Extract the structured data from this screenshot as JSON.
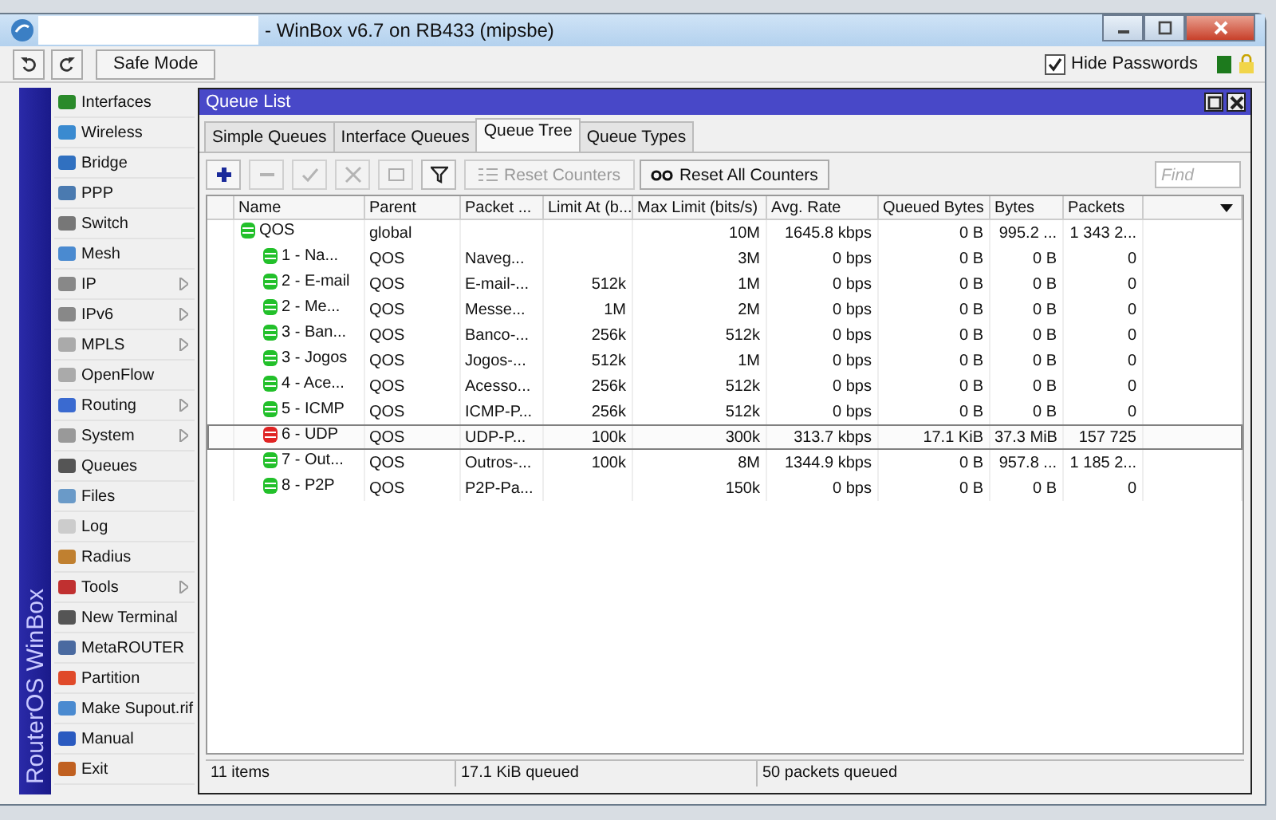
{
  "window": {
    "title": "- WinBox v6.7 on RB433 (mipsbe)"
  },
  "toolbar": {
    "safe_mode": "Safe Mode",
    "hide_passwords": {
      "label": "Hide Passwords",
      "checked": true
    }
  },
  "sidebar": {
    "brand": "RouterOS WinBox",
    "items": [
      {
        "label": "Interfaces",
        "has_submenu": false
      },
      {
        "label": "Wireless",
        "has_submenu": false
      },
      {
        "label": "Bridge",
        "has_submenu": false
      },
      {
        "label": "PPP",
        "has_submenu": false
      },
      {
        "label": "Switch",
        "has_submenu": false
      },
      {
        "label": "Mesh",
        "has_submenu": false
      },
      {
        "label": "IP",
        "has_submenu": true
      },
      {
        "label": "IPv6",
        "has_submenu": true
      },
      {
        "label": "MPLS",
        "has_submenu": true
      },
      {
        "label": "OpenFlow",
        "has_submenu": false
      },
      {
        "label": "Routing",
        "has_submenu": true
      },
      {
        "label": "System",
        "has_submenu": true
      },
      {
        "label": "Queues",
        "has_submenu": false
      },
      {
        "label": "Files",
        "has_submenu": false
      },
      {
        "label": "Log",
        "has_submenu": false
      },
      {
        "label": "Radius",
        "has_submenu": false
      },
      {
        "label": "Tools",
        "has_submenu": true
      },
      {
        "label": "New Terminal",
        "has_submenu": false
      },
      {
        "label": "MetaROUTER",
        "has_submenu": false
      },
      {
        "label": "Partition",
        "has_submenu": false
      },
      {
        "label": "Make Supout.rif",
        "has_submenu": false
      },
      {
        "label": "Manual",
        "has_submenu": false
      },
      {
        "label": "Exit",
        "has_submenu": false
      }
    ]
  },
  "queue_list": {
    "title": "Queue List",
    "tabs": [
      {
        "label": "Simple Queues",
        "selected": false
      },
      {
        "label": "Interface Queues",
        "selected": false
      },
      {
        "label": "Queue Tree",
        "selected": true
      },
      {
        "label": "Queue Types",
        "selected": false
      }
    ],
    "tools": [
      {
        "kind": "add",
        "disabled": false
      },
      {
        "kind": "remove",
        "disabled": true
      },
      {
        "kind": "enable",
        "disabled": true
      },
      {
        "kind": "disable",
        "disabled": true
      },
      {
        "kind": "comment",
        "disabled": true
      },
      {
        "kind": "filter",
        "disabled": false
      }
    ],
    "buttons": [
      {
        "kind": "reset",
        "label": "Reset Counters",
        "disabled": true
      },
      {
        "kind": "reset-all",
        "label": "Reset All Counters",
        "disabled": false
      }
    ],
    "search": {
      "placeholder": "Find"
    },
    "table": {
      "columns": [
        "Name",
        "Parent",
        "Packet ...",
        "Limit At (b...",
        "Max Limit (bits/s)",
        "Avg. Rate",
        "Queued Bytes",
        "Bytes",
        "Packets"
      ],
      "rows": [
        {
          "cells": [
            "QOS",
            "global",
            "",
            "",
            "10M",
            "1645.8 kbps",
            "0 B",
            "995.2 ...",
            "1 343 2..."
          ],
          "color": "#22c02a",
          "selected": false,
          "children": [
            {
              "cells": [
                "1 - Na...",
                "QOS",
                "Naveg...",
                "",
                "3M",
                "0 bps",
                "0 B",
                "0 B",
                "0"
              ],
              "color": "#22c02a",
              "selected": false
            },
            {
              "cells": [
                "2 - E-mail",
                "QOS",
                "E-mail-...",
                "512k",
                "1M",
                "0 bps",
                "0 B",
                "0 B",
                "0"
              ],
              "color": "#22c02a",
              "selected": false
            },
            {
              "cells": [
                "2 - Me...",
                "QOS",
                "Messe...",
                "1M",
                "2M",
                "0 bps",
                "0 B",
                "0 B",
                "0"
              ],
              "color": "#22c02a",
              "selected": false
            },
            {
              "cells": [
                "3 - Ban...",
                "QOS",
                "Banco-...",
                "256k",
                "512k",
                "0 bps",
                "0 B",
                "0 B",
                "0"
              ],
              "color": "#22c02a",
              "selected": false
            },
            {
              "cells": [
                "3 - Jogos",
                "QOS",
                "Jogos-...",
                "512k",
                "1M",
                "0 bps",
                "0 B",
                "0 B",
                "0"
              ],
              "color": "#22c02a",
              "selected": false
            },
            {
              "cells": [
                "4 - Ace...",
                "QOS",
                "Acesso...",
                "256k",
                "512k",
                "0 bps",
                "0 B",
                "0 B",
                "0"
              ],
              "color": "#22c02a",
              "selected": false
            },
            {
              "cells": [
                "5 - ICMP",
                "QOS",
                "ICMP-P...",
                "256k",
                "512k",
                "0 bps",
                "0 B",
                "0 B",
                "0"
              ],
              "color": "#22c02a",
              "selected": false
            },
            {
              "cells": [
                "6 - UDP",
                "QOS",
                "UDP-P...",
                "100k",
                "300k",
                "313.7 kbps",
                "17.1 KiB",
                "37.3 MiB",
                "157 725"
              ],
              "color": "#e02424",
              "selected": true
            },
            {
              "cells": [
                "7 - Out...",
                "QOS",
                "Outros-...",
                "100k",
                "8M",
                "1344.9 kbps",
                "0 B",
                "957.8 ...",
                "1 185 2..."
              ],
              "color": "#22c02a",
              "selected": false
            },
            {
              "cells": [
                "8 - P2P",
                "QOS",
                "P2P-Pa...",
                "",
                "150k",
                "0 bps",
                "0 B",
                "0 B",
                "0"
              ],
              "color": "#22c02a",
              "selected": false
            }
          ]
        }
      ]
    },
    "status_bar": [
      "11 items",
      "17.1 KiB queued",
      "50 packets queued"
    ]
  }
}
